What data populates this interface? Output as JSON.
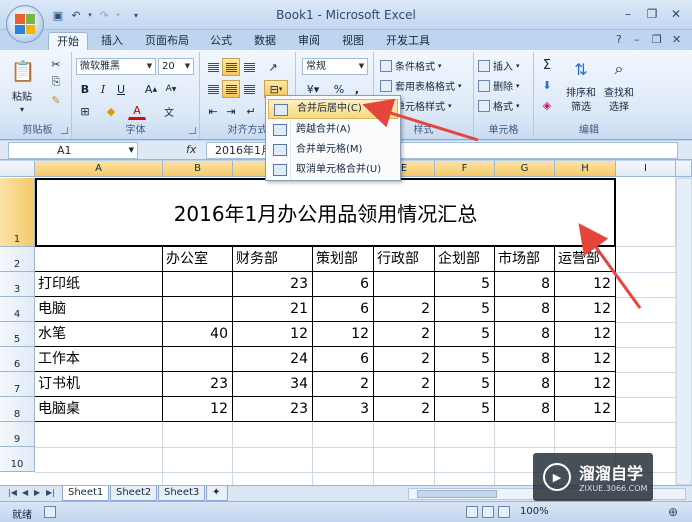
{
  "window": {
    "title": "Book1 - Microsoft Excel",
    "minimize": "–",
    "restore": "❐",
    "close": "✕"
  },
  "tabs": [
    "开始",
    "插入",
    "页面布局",
    "公式",
    "数据",
    "审阅",
    "视图",
    "开发工具"
  ],
  "ribbon": {
    "clipboard": {
      "label": "剪贴板",
      "paste": "粘贴"
    },
    "font": {
      "label": "字体",
      "name": "微软雅黑",
      "size": "20",
      "bold": "B",
      "italic": "I",
      "underline": "U"
    },
    "alignment": {
      "label": "对齐方式"
    },
    "number": {
      "label": "数字",
      "format": "常规",
      "percent": "%",
      "comma": ","
    },
    "styles": {
      "label": "样式",
      "conditional": "条件格式",
      "table": "套用表格格式",
      "cell": "单元格样式"
    },
    "cells": {
      "label": "单元格",
      "insert": "插入",
      "delete": "删除",
      "format": "格式"
    },
    "editing": {
      "label": "编辑",
      "sort": "排序和",
      "sort2": "筛选",
      "find": "查找和",
      "find2": "选择"
    }
  },
  "merge_menu": {
    "items": [
      "合并后居中(C)",
      "跨越合并(A)",
      "合并单元格(M)",
      "取消单元格合并(U)"
    ]
  },
  "formula_bar": {
    "name_box": "A1",
    "fx": "fx",
    "content": "2016年1月"
  },
  "columns": [
    "A",
    "B",
    "C",
    "D",
    "E",
    "F",
    "G",
    "H",
    "I"
  ],
  "rows": [
    "1",
    "2",
    "3",
    "4",
    "5",
    "6",
    "7",
    "8",
    "9",
    "10"
  ],
  "sheet": {
    "title": "2016年1月办公用品领用情况汇总",
    "headers": [
      "办公室",
      "财务部",
      "策划部",
      "行政部",
      "企划部",
      "市场部",
      "运营部"
    ],
    "items": [
      {
        "name": "打印纸",
        "values": [
          "",
          "23",
          "6",
          "",
          "5",
          "8",
          "12"
        ]
      },
      {
        "name": "电脑",
        "values": [
          "",
          "21",
          "6",
          "2",
          "5",
          "8",
          "12"
        ]
      },
      {
        "name": "水笔",
        "values": [
          "40",
          "12",
          "12",
          "2",
          "5",
          "8",
          "12"
        ]
      },
      {
        "name": "工作本",
        "values": [
          "",
          "24",
          "6",
          "2",
          "5",
          "8",
          "12"
        ]
      },
      {
        "name": "订书机",
        "values": [
          "23",
          "34",
          "2",
          "2",
          "5",
          "8",
          "12"
        ]
      },
      {
        "name": "电脑桌",
        "values": [
          "12",
          "23",
          "3",
          "2",
          "5",
          "8",
          "12"
        ]
      }
    ]
  },
  "sheet_tabs": [
    "Sheet1",
    "Sheet2",
    "Sheet3"
  ],
  "status": {
    "mode": "就绪",
    "zoom": "100%"
  },
  "watermark": {
    "name": "溜溜自学",
    "url": "ZIXUE.3066.COM"
  },
  "colors": {
    "accent_arrow": "#e5453a",
    "selection": "#f5c96a"
  }
}
